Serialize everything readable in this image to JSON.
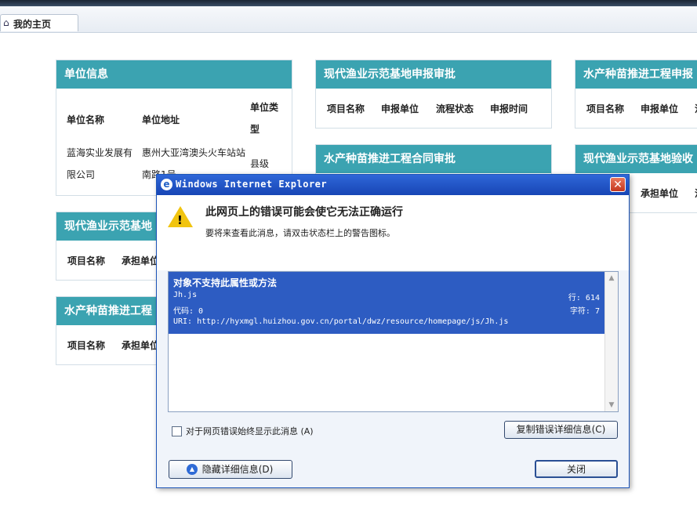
{
  "tab": {
    "icon": "home-icon",
    "label": "我的主页"
  },
  "panels": {
    "unit_info": {
      "title": "单位信息",
      "columns": [
        "单位名称",
        "单位地址",
        "单位类型"
      ],
      "row": {
        "name_line1": "蓝海实业发展有",
        "name_line2": "限公司",
        "addr_line1": "惠州大亚湾澳头火车站站",
        "addr_line2": "南路1号",
        "type": "县级"
      }
    },
    "demo_base_approval": {
      "title": "现代渔业示范基地申报审批",
      "columns": [
        "项目名称",
        "申报单位",
        "流程状态",
        "申报时间"
      ]
    },
    "seed_declare": {
      "title": "水产种苗推进工程申报",
      "columns": [
        "项目名称",
        "申报单位",
        "流"
      ]
    },
    "demo_base_left": {
      "title": "现代渔业示范基地",
      "columns": [
        "项目名称",
        "承担单位"
      ]
    },
    "contract_approval": {
      "title": "水产种苗推进工程合同审批"
    },
    "demo_base_accept": {
      "title": "现代渔业示范基地验收",
      "columns": [
        "承担单位",
        "流"
      ]
    },
    "seed_left": {
      "title": "水产种苗推进工程",
      "columns": [
        "项目名称",
        "承担单位"
      ]
    }
  },
  "dialog": {
    "title": "Windows Internet Explorer",
    "icon": "ie-icon",
    "headline": "此网页上的错误可能会使它无法正确运行",
    "subline": "要将来查看此消息，请双击状态栏上的警告图标。",
    "error": {
      "title": "对象不支持此属性或方法",
      "file": "Jh.js",
      "line_label": "行: 614",
      "code_label": "代码: 0",
      "char_label": "字符: 7",
      "uri": "URI: http://hyxmgl.huizhou.gov.cn/portal/dwz/resource/homepage/js/Jh.js"
    },
    "always_show_label": "对于网页错误始终显示此消息 (A)",
    "always_show_checked": false,
    "copy_button": "复制错误详细信息(C)",
    "hide_details_button": "隐藏详细信息(D)",
    "close_button": "关闭"
  }
}
